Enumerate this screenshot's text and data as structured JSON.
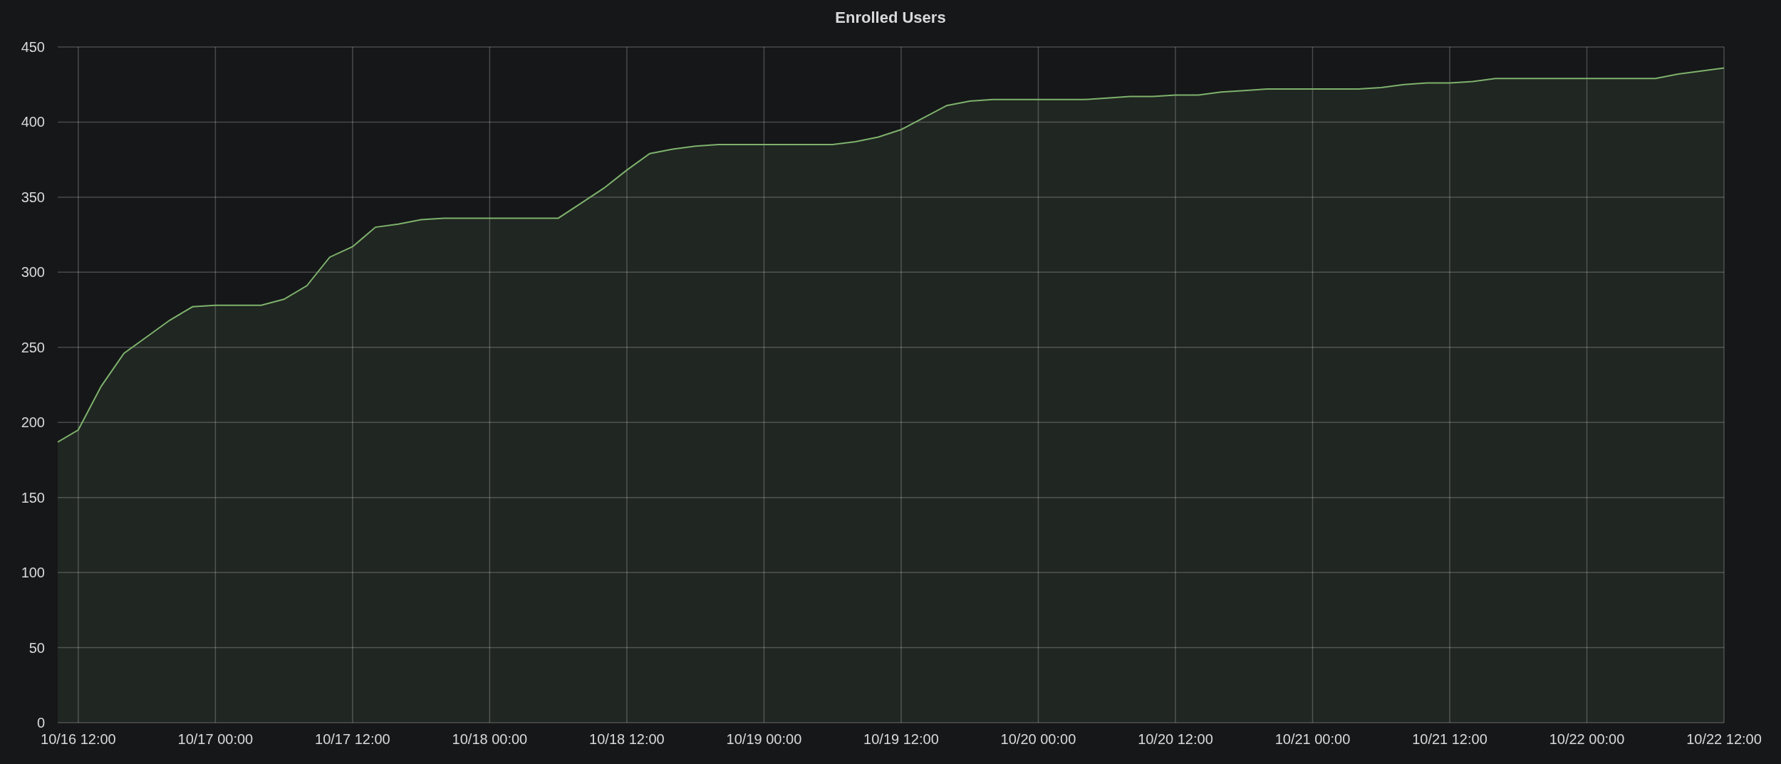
{
  "panel": {
    "chart_data": {
      "type": "area",
      "title": "Enrolled Users",
      "grid": true,
      "ylim": [
        0,
        450
      ],
      "yticks": [
        0,
        50,
        100,
        150,
        200,
        250,
        300,
        350,
        400,
        450
      ],
      "categories": [
        null,
        "10/16 12:00",
        null,
        null,
        null,
        null,
        null,
        "10/17 00:00",
        null,
        null,
        null,
        null,
        null,
        "10/17 12:00",
        null,
        null,
        null,
        null,
        null,
        "10/18 00:00",
        null,
        null,
        null,
        null,
        null,
        "10/18 12:00",
        null,
        null,
        null,
        null,
        null,
        "10/19 00:00",
        null,
        null,
        null,
        null,
        null,
        "10/19 12:00",
        null,
        null,
        null,
        null,
        null,
        "10/20 00:00",
        null,
        null,
        null,
        null,
        null,
        "10/20 12:00",
        null,
        null,
        null,
        null,
        null,
        "10/21 00:00",
        null,
        null,
        null,
        null,
        null,
        "10/21 12:00",
        null,
        null,
        null,
        null,
        null,
        "10/22 00:00",
        null,
        null,
        null,
        null,
        null,
        "10/22 12:00"
      ],
      "series": [
        {
          "color": "#7eb26d",
          "values": [
            186,
            195,
            224,
            246,
            257,
            268,
            277,
            278,
            278,
            278,
            282,
            291,
            310,
            317,
            330,
            332,
            335,
            336,
            336,
            336,
            336,
            336,
            336,
            346,
            356,
            368,
            379,
            382,
            384,
            385,
            385,
            385,
            385,
            385,
            385,
            387,
            390,
            395,
            403,
            411,
            414,
            415,
            415,
            415,
            415,
            415,
            416,
            417,
            417,
            418,
            418,
            420,
            421,
            422,
            422,
            422,
            422,
            422,
            423,
            425,
            426,
            426,
            427,
            429,
            429,
            429,
            429,
            429,
            429,
            429,
            429,
            432,
            434,
            436
          ]
        }
      ]
    }
  }
}
